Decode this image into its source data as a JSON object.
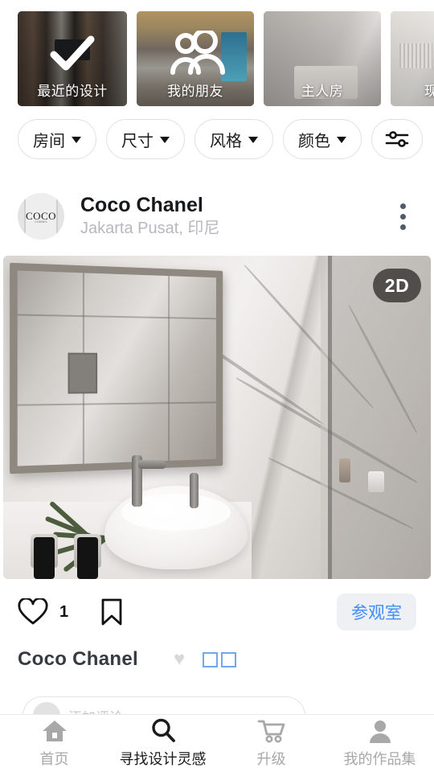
{
  "carousel": {
    "cards": [
      {
        "label": "最近的设计",
        "icon": "check-icon",
        "art": "living-room"
      },
      {
        "label": "我的朋友",
        "icon": "friends-icon",
        "art": "loft-room"
      },
      {
        "label": "主人房",
        "icon": "",
        "art": "bedroom"
      },
      {
        "label": "现代厨",
        "icon": "",
        "art": "kitchen"
      }
    ]
  },
  "filters": {
    "chips": [
      {
        "label": "房间",
        "caret": "chevron-down-icon"
      },
      {
        "label": "尺寸",
        "caret": "chevron-down-icon"
      },
      {
        "label": "风格",
        "caret": "chevron-down-icon"
      },
      {
        "label": "颜色",
        "caret": "chevron-down-icon"
      }
    ],
    "tune_icon": "sliders-icon"
  },
  "post": {
    "avatar_text": "COCO",
    "avatar_subtext": "CHANEL",
    "username": "Coco Chanel",
    "location": "Jakarta Pusat, 印尼",
    "menu_icon": "kebab-menu-icon",
    "image_badge": "2D",
    "image_alt": "marble-bathroom-render"
  },
  "actions": {
    "like_icon": "heart-outline-icon",
    "like_count": "1",
    "bookmark_icon": "bookmark-outline-icon",
    "visit_label": "参观室"
  },
  "caption": {
    "name": "Coco Chanel",
    "heart_emoji": "♥",
    "tofu_count": 2
  },
  "comment": {
    "placeholder": "添加评论"
  },
  "bottomnav": {
    "items": [
      {
        "label": "首页",
        "icon": "home-icon",
        "active": false
      },
      {
        "label": "寻找设计灵感",
        "icon": "search-icon",
        "active": true
      },
      {
        "label": "升级",
        "icon": "cart-icon",
        "active": false
      },
      {
        "label": "我的作品集",
        "icon": "person-icon",
        "active": false
      }
    ]
  },
  "colors": {
    "accent_blue": "#3f8ef7",
    "visit_bg": "#eef0f4",
    "tofu_border": "#6fa8f0",
    "nav_inactive": "#a8a8a8",
    "nav_active": "#1b1b1b",
    "badge_bg": "#383432"
  }
}
